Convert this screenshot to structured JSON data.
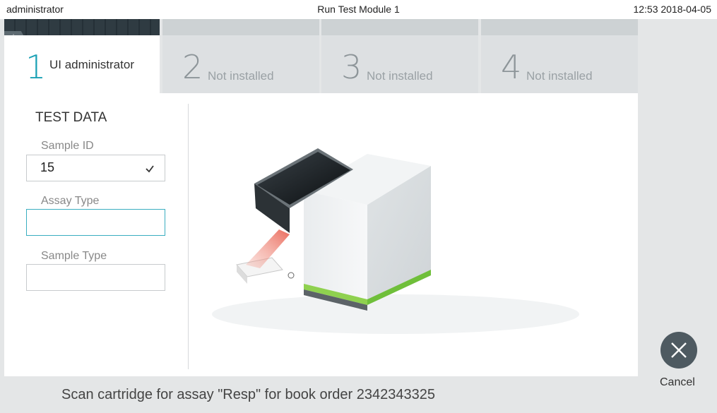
{
  "statusbar": {
    "user": "administrator",
    "title": "Run Test Module 1",
    "datetime": "12:53 2018-04-05"
  },
  "modules": [
    {
      "number": "1",
      "label": "UI administrator",
      "badge": "--:--",
      "active": true
    },
    {
      "number": "2",
      "label": "Not installed"
    },
    {
      "number": "3",
      "label": "Not installed"
    },
    {
      "number": "4",
      "label": "Not installed"
    }
  ],
  "test_data": {
    "heading": "TEST DATA",
    "sample_id": {
      "label": "Sample ID",
      "value": "15"
    },
    "assay_type": {
      "label": "Assay Type",
      "value": ""
    },
    "sample_type": {
      "label": "Sample Type",
      "value": ""
    }
  },
  "actions": {
    "cancel_label": "Cancel"
  },
  "message": "Scan cartridge for assay \"Resp\" for book order 2342343325",
  "colors": {
    "accent": "#1aa1b5",
    "focus_border": "#3aaec0",
    "header_dark": "#2f3b42",
    "cancel_button": "#4e5a61",
    "background": "#e4e6e7"
  }
}
